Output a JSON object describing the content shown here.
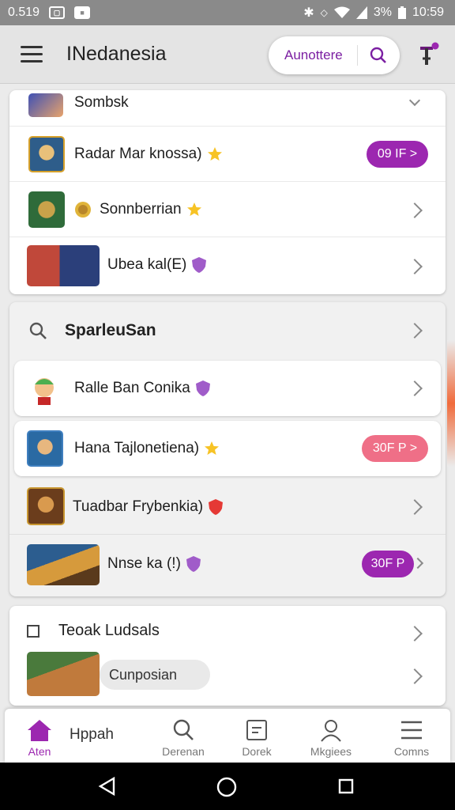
{
  "status_bar": {
    "time": "0.519",
    "battery": "3%",
    "clock": "10:59"
  },
  "app_bar": {
    "title": "INedanesia",
    "search_label": "Aunottere"
  },
  "list1": [
    {
      "name": "Sombsk",
      "badge": "none",
      "action": "chevron"
    },
    {
      "name": "Radar Mar knossa)",
      "badge": "star",
      "action": "pill",
      "pill_label": "09 IF >"
    },
    {
      "name": "Sonnberrian",
      "badge": "star",
      "action": "chevron"
    },
    {
      "name": "Ubea kal(E)",
      "badge": "shield-purple",
      "action": "chevron"
    }
  ],
  "section2": {
    "title": "SparleuSan",
    "items": [
      {
        "name": "Ralle Ban Conika",
        "badge": "shield-purple",
        "action": "chevron"
      },
      {
        "name": "Hana Tajlonetiena)",
        "badge": "star",
        "action": "pill",
        "pill_label": "30F P >",
        "pill_color": "pink"
      },
      {
        "name": "Tuadbar Frybenkia)",
        "badge": "shield-red",
        "action": "chevron"
      },
      {
        "name": "Nnse ka (!)",
        "badge": "shield-purple",
        "action": "pill",
        "pill_label": "30F P",
        "pill_color": "purple"
      }
    ]
  },
  "section3": {
    "title": "Teoak Ludsals",
    "chip": "Cunposian"
  },
  "bottom_nav": {
    "home_extra": "Hppah",
    "items": [
      {
        "label": "Aten",
        "icon": "home-icon"
      },
      {
        "label": "Derenan",
        "icon": "search-icon"
      },
      {
        "label": "Dorek",
        "icon": "document-icon"
      },
      {
        "label": "Mkgiees",
        "icon": "person-icon"
      },
      {
        "label": "Comns",
        "icon": "menu-icon"
      }
    ]
  },
  "colors": {
    "accent": "#9c27b0",
    "pink": "#ef6f87",
    "star": "#f7c325"
  }
}
